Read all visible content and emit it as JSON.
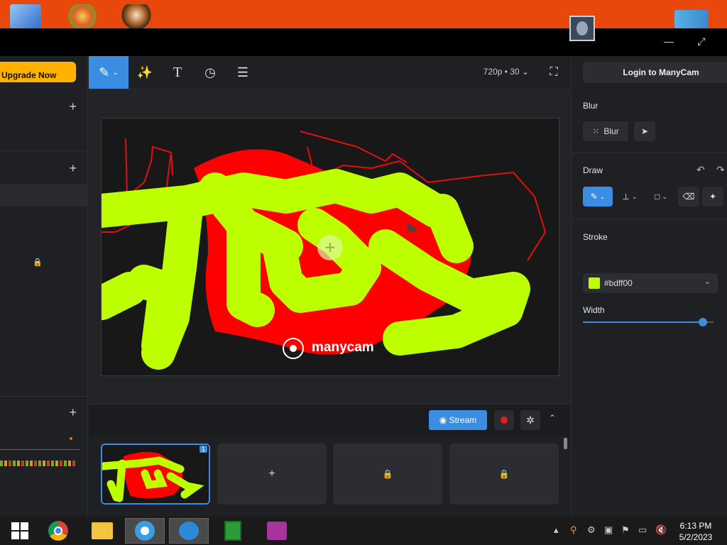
{
  "desktop": {
    "icons": [
      "computer-icon",
      "app-icon",
      "app-icon-2",
      "download-icon",
      "app-icon-3"
    ]
  },
  "window": {
    "minimize_glyph": "—",
    "maximize_glyph": "⤢"
  },
  "left_panel": {
    "upgrade_label": "Upgrade Now",
    "section_add_glyph": "+",
    "lock_glyph": "🔒"
  },
  "toolbar": {
    "tools": [
      {
        "name": "draw-tool",
        "glyph": "✎",
        "active": true
      },
      {
        "name": "effects-tool",
        "glyph": "✨"
      },
      {
        "name": "text-tool",
        "glyph": "T"
      },
      {
        "name": "timer-tool",
        "glyph": "◷"
      },
      {
        "name": "lower-thirds-tool",
        "glyph": "☰"
      }
    ],
    "resolution": "720p • 30",
    "fullscreen_glyph": "⛶"
  },
  "preview": {
    "watermark": "manycam"
  },
  "controls": {
    "stream_label": "Stream",
    "stream_icon": "broadcast-icon",
    "snapshot_glyph": "✲",
    "collapse_glyph": "⌃"
  },
  "scenes": {
    "badge": "1",
    "add_glyph": "+",
    "lock_glyph": "🔒"
  },
  "right_panel": {
    "login_label": "Login to ManyCam",
    "blur_title": "Blur",
    "blur_button": "Blur",
    "draw_title": "Draw",
    "stroke_title": "Stroke",
    "stroke_color_label": "#bdff00",
    "width_title": "Width",
    "width_value": 0.92
  },
  "colors": {
    "accent": "#3a8de0",
    "upgrade": "#ffb300",
    "stroke": "#bdff00",
    "draw_red": "#ff0000"
  },
  "taskbar": {
    "time": "6:13 PM",
    "date": "5/2/2023"
  }
}
